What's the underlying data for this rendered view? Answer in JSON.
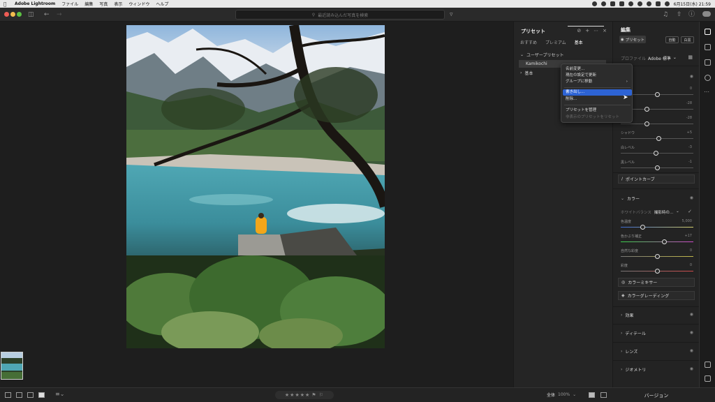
{
  "menubar": {
    "apple": "",
    "app_name": "Adobe Lightroom",
    "items": [
      "ファイル",
      "編集",
      "写真",
      "表示",
      "ウィンドウ",
      "ヘルプ"
    ],
    "datetime": "6月15日(水) 21:59"
  },
  "titlebar": {
    "search_placeholder": "最近読み込んだ写真を検索"
  },
  "presets": {
    "title": "プリセット",
    "tools": [
      "⊘",
      "+",
      "⋯",
      "×"
    ],
    "tabs": [
      {
        "label": "おすすめ",
        "active": false
      },
      {
        "label": "プレミアム",
        "active": false
      },
      {
        "label": "基本",
        "active": true
      }
    ],
    "user_group": "ユーザープリセット",
    "selected_item": "Kamikochi",
    "basic_group": "基本"
  },
  "context_menu": {
    "items": [
      {
        "label": "名前変更...",
        "state": "normal"
      },
      {
        "label": "現在の設定で更新",
        "state": "normal"
      },
      {
        "label": "グループに移動",
        "state": "submenu"
      },
      {
        "label": "書き出し...",
        "state": "highlighted"
      },
      {
        "label": "削除...",
        "state": "normal"
      },
      {
        "label": "プリセットを管理",
        "state": "normal"
      },
      {
        "label": "非表示のプリセットをリセット",
        "state": "disabled"
      }
    ]
  },
  "edit": {
    "title": "編集",
    "preset_button": "プリセット",
    "auto_button": "自動",
    "bw_button": "白黒",
    "profile_label": "プロファイル",
    "profile_value": "Adobe 標準",
    "light_section": "ト",
    "light_sliders": [
      {
        "label": "",
        "value": "0",
        "pos": 0.5
      },
      {
        "label": "ラスト",
        "value": "-28",
        "pos": 0.36
      },
      {
        "label": "イト",
        "value": "-28",
        "pos": 0.36
      },
      {
        "label": "シャドウ",
        "value": "+5",
        "pos": 0.52
      },
      {
        "label": "白レベル",
        "value": "-3",
        "pos": 0.49
      },
      {
        "label": "黒レベル",
        "value": "-1",
        "pos": 0.5
      }
    ],
    "point_curve": "ポイントカーブ",
    "color_section": "カラー",
    "wb_label": "ホワイトバランス",
    "wb_value": "撮影時の...",
    "color_sliders": [
      {
        "label": "色温度",
        "value": "5,000",
        "pos": 0.3
      },
      {
        "label": "色かぶり補正",
        "value": "+17",
        "pos": 0.6
      },
      {
        "label": "自然な彩度",
        "value": "0",
        "pos": 0.5
      },
      {
        "label": "彩度",
        "value": "0",
        "pos": 0.5
      }
    ],
    "color_mixer": "カラーミキサー",
    "color_grading": "カラーグレーディング",
    "sections": [
      "効果",
      "ディテール",
      "レンズ",
      "ジオメトリ"
    ],
    "version_button": "バージョン"
  },
  "bottombar": {
    "stars": "★★★★★",
    "flags": "⚑ ⚐",
    "zoom_label": "全体",
    "zoom_pct": "100%"
  }
}
